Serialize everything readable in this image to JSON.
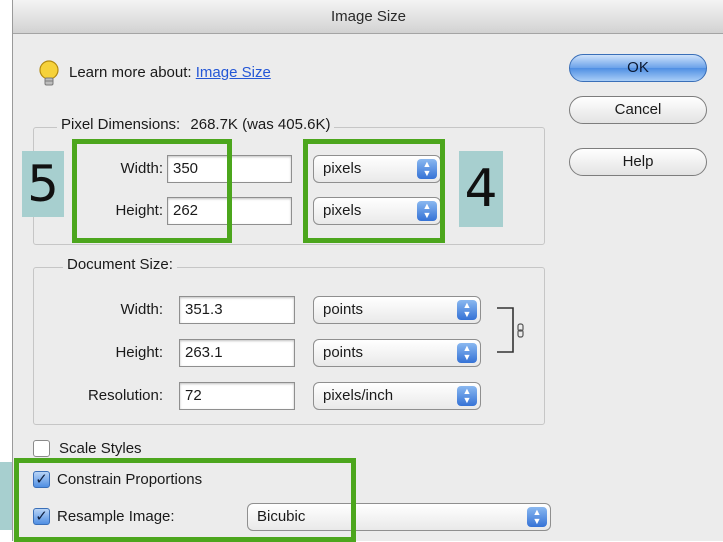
{
  "window": {
    "title": "Image Size"
  },
  "help_hint": {
    "prefix": "Learn more about:",
    "link": "Image Size",
    "icon": "lightbulb-icon"
  },
  "pixel_dimensions": {
    "legend": "Pixel Dimensions:",
    "size_text": "268.7K (was 405.6K)",
    "width_label": "Width:",
    "width_value": "350",
    "width_unit": "pixels",
    "height_label": "Height:",
    "height_value": "262",
    "height_unit": "pixels"
  },
  "document_size": {
    "legend": "Document Size:",
    "width_label": "Width:",
    "width_value": "351.3",
    "width_unit": "points",
    "height_label": "Height:",
    "height_value": "263.1",
    "height_unit": "points",
    "resolution_label": "Resolution:",
    "resolution_value": "72",
    "resolution_unit": "pixels/inch",
    "link_icon": "chain-link-icon"
  },
  "options": {
    "scale_styles": {
      "label": "Scale Styles",
      "checked": false
    },
    "constrain_proportions": {
      "label": "Constrain Proportions",
      "checked": true
    },
    "resample_image": {
      "label": "Resample Image:",
      "checked": true,
      "method": "Bicubic"
    }
  },
  "buttons": {
    "ok": "OK",
    "cancel": "Cancel",
    "help": "Help"
  },
  "annotations": {
    "marker_5": "5",
    "marker_4": "4"
  },
  "colors": {
    "highlight": "#4ca61d",
    "marker_bg": "#a7cfcf",
    "default_button": "#4f8fe3"
  }
}
